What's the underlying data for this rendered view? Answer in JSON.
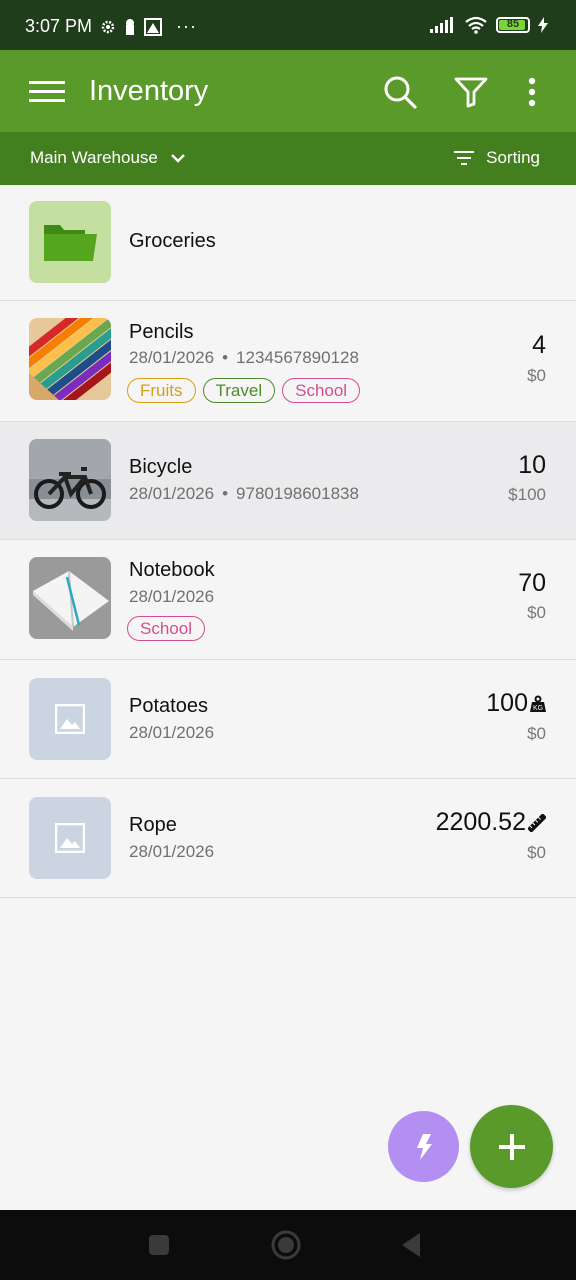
{
  "status_bar": {
    "time": "3:07 PM",
    "more": "···",
    "battery": "85"
  },
  "app_bar": {
    "title": "Inventory",
    "menu_icon": "hamburger-icon",
    "search_icon": "search-icon",
    "filter_icon": "filter-icon",
    "more_icon": "more-vert-icon"
  },
  "sub_bar": {
    "location": "Main Warehouse",
    "sorting_label": "Sorting"
  },
  "items": [
    {
      "name": "Groceries",
      "type": "folder"
    },
    {
      "name": "Pencils",
      "date": "28/01/2026",
      "barcode": "1234567890128",
      "quantity": "4",
      "price": "$0",
      "tags": [
        {
          "label": "Fruits",
          "color": "#d4a017"
        },
        {
          "label": "Travel",
          "color": "#4f8a2b"
        },
        {
          "label": "School",
          "color": "#d44e8e"
        }
      ]
    },
    {
      "name": "Bicycle",
      "date": "28/01/2026",
      "barcode": "9780198601838",
      "quantity": "10",
      "price": "$100"
    },
    {
      "name": "Notebook",
      "date": "28/01/2026",
      "quantity": "70",
      "price": "$0",
      "tags": [
        {
          "label": "School",
          "color": "#d44e8e"
        }
      ]
    },
    {
      "name": "Potatoes",
      "date": "28/01/2026",
      "quantity": "100",
      "price": "$0",
      "unit_icon": "weight-icon"
    },
    {
      "name": "Rope",
      "date": "28/01/2026",
      "quantity": "2200.52",
      "price": "$0",
      "unit_icon": "ruler-icon"
    }
  ],
  "colors": {
    "app_bar": "#5a9a2b",
    "sub_bar": "#437f1f",
    "status_bar": "#1f3d1a",
    "fab_add": "#5a9a2b",
    "fab_quick": "#b48ff2"
  }
}
